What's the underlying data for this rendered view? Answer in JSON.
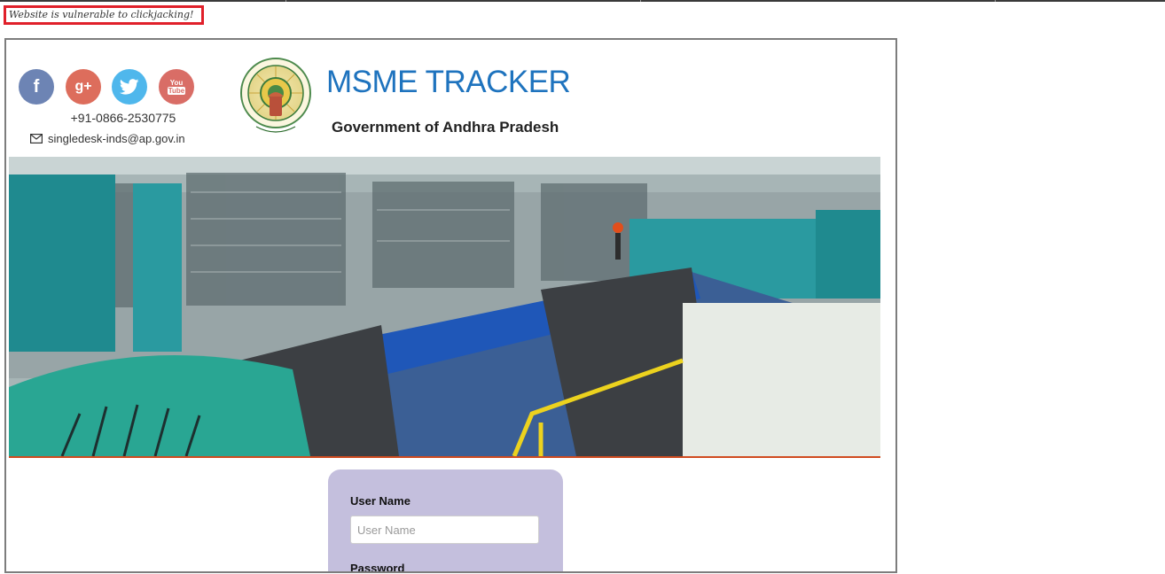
{
  "warning": {
    "text": "Website is vulnerable to clickjacking!"
  },
  "header": {
    "brand": "MSME TRACKER",
    "subtitle": "Government of Andhra Pradesh",
    "phone": "+91-0866-2530775",
    "email": "singledesk-inds@ap.gov.in"
  },
  "social": {
    "facebook_glyph": "f",
    "googleplus_glyph": "g+",
    "youtube_glyph_top": "You",
    "youtube_glyph_bottom": "Tube"
  },
  "login": {
    "username_label": "User Name",
    "username_placeholder": "User Name",
    "username_value": "",
    "password_label": "Password"
  },
  "icons": {
    "facebook": "facebook-icon",
    "googleplus": "google-plus-icon",
    "twitter": "twitter-icon",
    "youtube": "youtube-icon",
    "mail": "envelope-icon",
    "emblem": "ap-state-emblem",
    "scroll_up": "chevron-up-icon",
    "scroll_down": "chevron-down-icon"
  },
  "colors": {
    "brand": "#1e73be",
    "warning_border": "#e0202a",
    "login_panel": "#c4bfdd",
    "hero_divider": "#d04b1f",
    "facebook": "#6d84b4",
    "googleplus": "#dd6d5c",
    "twitter": "#4fb7ec",
    "youtube": "#d96d66"
  }
}
